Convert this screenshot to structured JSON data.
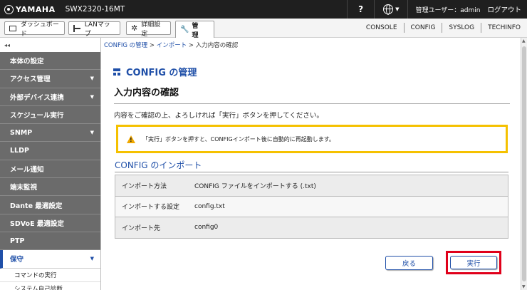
{
  "topbar": {
    "brand": "YAMAHA",
    "model": "SWX2320-16MT",
    "help": "?",
    "user": "管理ユーザー：admin",
    "logout": "ログアウト"
  },
  "navbar": {
    "dashboard": "ダッシュボード",
    "lanmap": "LANマップ",
    "detail": "詳細設定",
    "manage": "管 理",
    "links": [
      "CONSOLE",
      "CONFIG",
      "SYSLOG",
      "TECHINFO"
    ]
  },
  "sidebar": {
    "collapse": "◂◂",
    "items": [
      {
        "label": "本体の設定",
        "arrow": false
      },
      {
        "label": "アクセス管理",
        "arrow": true
      },
      {
        "label": "外部デバイス連携",
        "arrow": true
      },
      {
        "label": "スケジュール実行",
        "arrow": false
      },
      {
        "label": "SNMP",
        "arrow": true
      },
      {
        "label": "LLDP",
        "arrow": false
      },
      {
        "label": "メール通知",
        "arrow": false
      },
      {
        "label": "端末監視",
        "arrow": false
      },
      {
        "label": "Dante 最適設定",
        "arrow": false
      },
      {
        "label": "SDVoE 最適設定",
        "arrow": false
      },
      {
        "label": "PTP",
        "arrow": false
      }
    ],
    "active": {
      "label": "保守"
    },
    "subitems": [
      "コマンドの実行",
      "システム自己診断"
    ]
  },
  "breadcrumb": {
    "parts": [
      "CONFIG の管理",
      "インポート",
      "入力内容の確認"
    ]
  },
  "page": {
    "title": "CONFIG の管理",
    "subtitle": "入力内容の確認",
    "description": "内容をご確認の上、よろしければ「実行」ボタンを押してください。",
    "warning": "「実行」ボタンを押すと、CONFIGインポート後に自動的に再起動します。",
    "section_title": "CONFIG のインポート",
    "rows": [
      {
        "key": "インポート方法",
        "value": "CONFIG ファイルをインポートする (.txt)"
      },
      {
        "key": "インポートする設定",
        "value": "config.txt"
      },
      {
        "key": "インポート先",
        "value": "config0"
      }
    ],
    "back_button": "戻る",
    "exec_button": "実行"
  },
  "colors": {
    "accent": "#1f4fa8",
    "warning_border": "#f5c100",
    "highlight": "#e0001a",
    "topbar": "#1f1f1f",
    "sidebar_item": "#6b6b6b"
  }
}
